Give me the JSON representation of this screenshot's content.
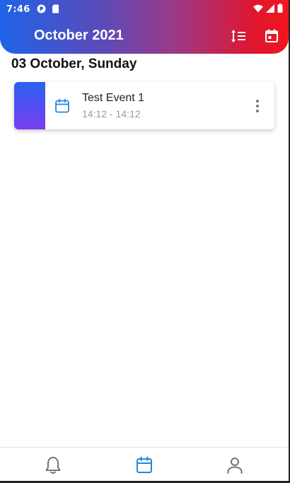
{
  "status_bar": {
    "time": "7:46"
  },
  "app_bar": {
    "title": "October 2021",
    "sort_icon": "sort-icon",
    "calendar_icon": "calendar-today-icon"
  },
  "day_section": {
    "heading": "03 October, Sunday"
  },
  "events": [
    {
      "title": "Test Event 1",
      "time": "14:12 - 14:12",
      "icon": "calendar-icon",
      "color_start": "#2a62f0",
      "color_end": "#7a3ef0"
    }
  ],
  "bottom_nav": [
    {
      "name": "notifications",
      "icon": "bell-icon",
      "active": false
    },
    {
      "name": "calendar",
      "icon": "calendar-icon",
      "active": true
    },
    {
      "name": "profile",
      "icon": "person-icon",
      "active": false
    }
  ],
  "colors": {
    "accent": "#1e88e5",
    "gradient_start": "#1f63e8",
    "gradient_end": "#f2161e",
    "inactive_icon": "#666666"
  }
}
